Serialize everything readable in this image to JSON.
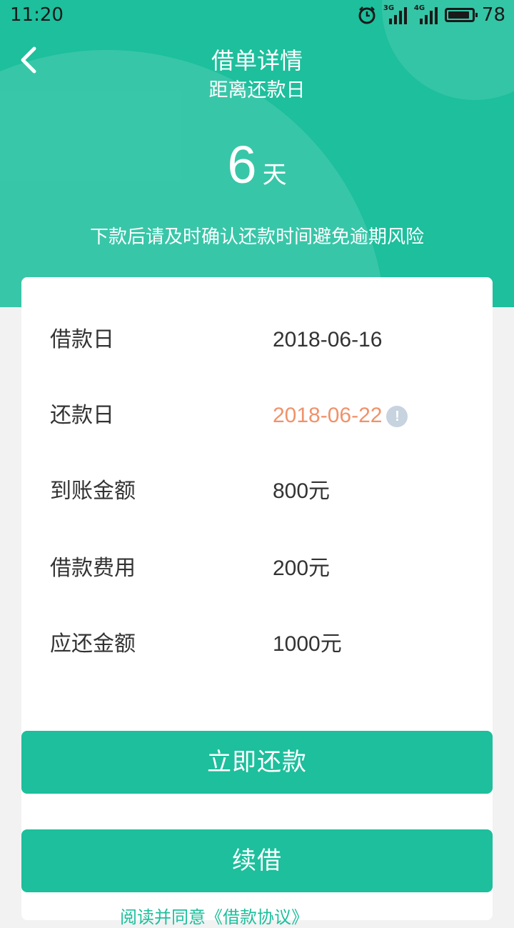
{
  "status_bar": {
    "time": "11:20",
    "network_1": "3G",
    "network_2": "4G",
    "battery": "78"
  },
  "header": {
    "title": "借单详情",
    "subtitle": "距离还款日",
    "days_value": "6",
    "days_unit": "天",
    "tip": "下款后请及时确认还款时间避免逾期风险"
  },
  "details": [
    {
      "label": "借款日",
      "value": "2018-06-16"
    },
    {
      "label": "还款日",
      "value": "2018-06-22"
    },
    {
      "label": "到账金额",
      "value": "800元"
    },
    {
      "label": "借款费用",
      "value": "200元"
    },
    {
      "label": "应还金额",
      "value": "1000元"
    }
  ],
  "buttons": {
    "repay": "立即还款",
    "renew": "续借"
  },
  "agreement_text": "阅读并同意《借款协议》",
  "colors": {
    "primary": "#1dbf9c",
    "due_date": "#f0926a",
    "background": "#f2f2f2"
  }
}
